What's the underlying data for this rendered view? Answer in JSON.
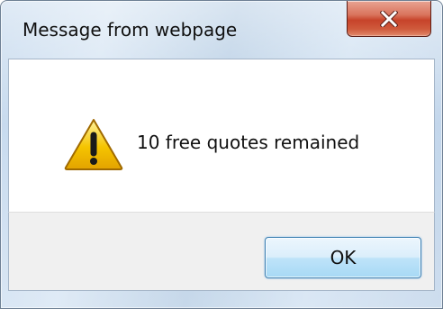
{
  "dialog": {
    "title": "Message from webpage",
    "message": "10 free quotes remained",
    "icon": "warning-icon",
    "ok_label": "OK",
    "close_icon": "close-icon"
  },
  "colors": {
    "close_button": "#c7432a",
    "ok_button_border": "#3c7fb1",
    "warning_fill": "#f5c400"
  }
}
